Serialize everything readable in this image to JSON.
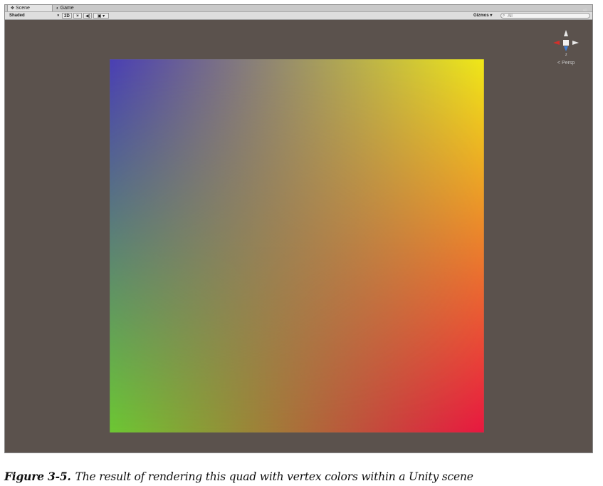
{
  "tabs": [
    {
      "label": "Scene",
      "icon": "scene-icon",
      "active": true
    },
    {
      "label": "Game",
      "icon": "game-icon",
      "active": false
    }
  ],
  "toolbar": {
    "shading_mode": "Shaded",
    "mode_2d": "2D",
    "lighting_icon": "sun-icon",
    "audio_icon": "speaker-icon",
    "effects_icon": "image-icon",
    "gizmos": "Gizmos",
    "search_value": "All"
  },
  "scene": {
    "projection_label": "< Persp",
    "gizmo_axis_label": "z",
    "quad_colors": {
      "top_left": "#4a3fb5",
      "top_right": "#f0e818",
      "bottom_left": "#6cc832",
      "bottom_right": "#e81640",
      "background": "#5b524d"
    }
  },
  "caption": {
    "figure_label": "Figure 3-5.",
    "text": "The result of rendering this quad with vertex colors within a Unity scene"
  }
}
